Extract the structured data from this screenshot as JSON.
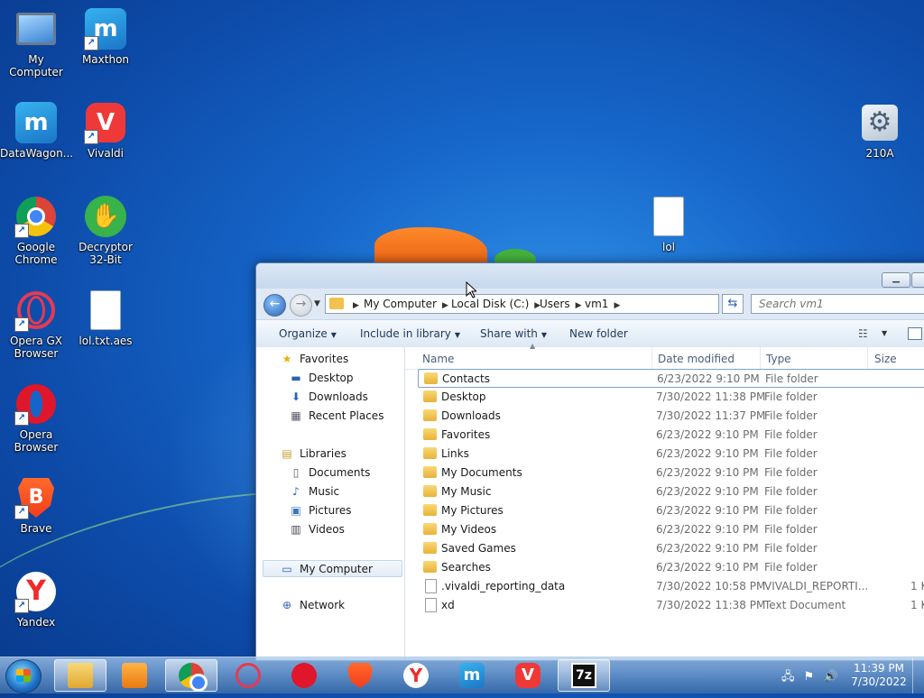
{
  "desktop": {
    "icons": [
      {
        "key": "mycomputer",
        "label": "My Computer",
        "shortcut": false
      },
      {
        "key": "maxthon",
        "label": "Maxthon",
        "shortcut": true
      },
      {
        "key": "datawagon",
        "label": "DataWagon...",
        "shortcut": false
      },
      {
        "key": "vivaldi",
        "label": "Vivaldi",
        "shortcut": true
      },
      {
        "key": "chrome",
        "label": "Google Chrome",
        "shortcut": true
      },
      {
        "key": "decryptor",
        "label": "Decryptor 32-Bit",
        "shortcut": false
      },
      {
        "key": "operagx",
        "label": "Opera GX Browser",
        "shortcut": true
      },
      {
        "key": "loltxtaes",
        "label": "lol.txt.aes",
        "shortcut": false
      },
      {
        "key": "opera",
        "label": "Opera Browser",
        "shortcut": true
      },
      {
        "key": "brave",
        "label": "Brave",
        "shortcut": true
      },
      {
        "key": "yandex",
        "label": "Yandex",
        "shortcut": true
      },
      {
        "key": "lol",
        "label": "lol",
        "shortcut": false
      },
      {
        "key": "210a",
        "label": "210A",
        "shortcut": false
      }
    ]
  },
  "explorer": {
    "minimize_glyph": "▁",
    "address": {
      "crumbs": [
        "My Computer",
        "Local Disk (C:)",
        "Users",
        "vm1"
      ]
    },
    "search_placeholder": "Search vm1",
    "toolbar": {
      "organize": "Organize",
      "include_in_library": "Include in library",
      "share_with": "Share with",
      "new_folder": "New folder"
    },
    "nav": {
      "favorites": "Favorites",
      "desktop": "Desktop",
      "downloads": "Downloads",
      "recent_places": "Recent Places",
      "libraries": "Libraries",
      "documents": "Documents",
      "music": "Music",
      "pictures": "Pictures",
      "videos": "Videos",
      "my_computer": "My Computer",
      "network": "Network"
    },
    "columns": {
      "name": "Name",
      "date": "Date modified",
      "type": "Type",
      "size": "Size"
    },
    "files": [
      {
        "name": "Contacts",
        "date": "6/23/2022 9:10 PM",
        "type": "File folder",
        "size": "",
        "kind": "folder"
      },
      {
        "name": "Desktop",
        "date": "7/30/2022 11:38 PM",
        "type": "File folder",
        "size": "",
        "kind": "folder"
      },
      {
        "name": "Downloads",
        "date": "7/30/2022 11:37 PM",
        "type": "File folder",
        "size": "",
        "kind": "folder"
      },
      {
        "name": "Favorites",
        "date": "6/23/2022 9:10 PM",
        "type": "File folder",
        "size": "",
        "kind": "folder"
      },
      {
        "name": "Links",
        "date": "6/23/2022 9:10 PM",
        "type": "File folder",
        "size": "",
        "kind": "folder"
      },
      {
        "name": "My Documents",
        "date": "6/23/2022 9:10 PM",
        "type": "File folder",
        "size": "",
        "kind": "folder"
      },
      {
        "name": "My Music",
        "date": "6/23/2022 9:10 PM",
        "type": "File folder",
        "size": "",
        "kind": "folder"
      },
      {
        "name": "My Pictures",
        "date": "6/23/2022 9:10 PM",
        "type": "File folder",
        "size": "",
        "kind": "folder"
      },
      {
        "name": "My Videos",
        "date": "6/23/2022 9:10 PM",
        "type": "File folder",
        "size": "",
        "kind": "folder"
      },
      {
        "name": "Saved Games",
        "date": "6/23/2022 9:10 PM",
        "type": "File folder",
        "size": "",
        "kind": "folder"
      },
      {
        "name": "Searches",
        "date": "6/23/2022 9:10 PM",
        "type": "File folder",
        "size": "",
        "kind": "folder"
      },
      {
        "name": ".vivaldi_reporting_data",
        "date": "7/30/2022 10:58 PM",
        "type": "VIVALDI_REPORTI...",
        "size": "1 K",
        "kind": "file"
      },
      {
        "name": "xd",
        "date": "7/30/2022 11:38 PM",
        "type": "Text Document",
        "size": "1 K",
        "kind": "file"
      }
    ]
  },
  "taskbar": {
    "apps": [
      "explorer",
      "media-player",
      "chrome",
      "opera-gx",
      "opera",
      "brave",
      "yandex",
      "maxthon",
      "vivaldi",
      "7zip"
    ],
    "seven_zip_label": "7z",
    "time": "11:39 PM",
    "date": "7/30/2022"
  }
}
